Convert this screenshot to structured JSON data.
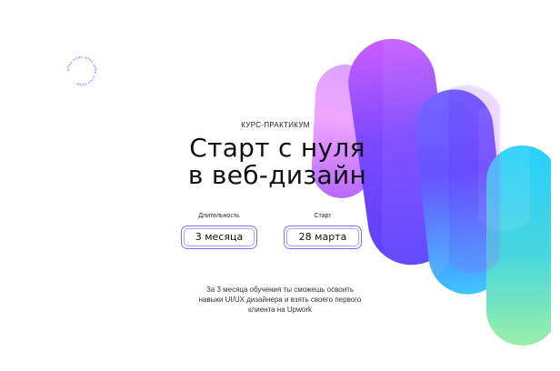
{
  "header": {
    "eyebrow": "КУРС-ПРАКТИКУМ"
  },
  "hero": {
    "title_line_1": "Старт с нуля",
    "title_line_2": "в веб-дизайн"
  },
  "details": {
    "duration_label": "Длительность",
    "duration_value": "3 месяца",
    "start_label": "Старт",
    "start_value": "28 марта"
  },
  "description": {
    "line_1": "За 3 месяца обучения ты сможешь освоить",
    "line_2": "навыки UI/UX дизайнера и взять своего первого",
    "line_3": "клиента на Upwork"
  },
  "badge": {
    "text": "ui/ux ui/ux ui/ux ui/ux ui/ux ui/ux "
  },
  "colors": {
    "accent": "#6b4cff",
    "text": "#111111",
    "secondary_text": "#333333",
    "background": "#ffffff"
  },
  "icons": {
    "badge": "circular-text-badge-icon",
    "gradient_art": "gradient-ribbon-art"
  }
}
